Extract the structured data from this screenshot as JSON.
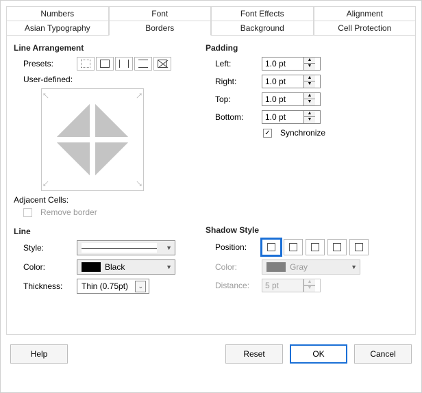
{
  "tabs": {
    "row1": [
      "Numbers",
      "Font",
      "Font Effects",
      "Alignment"
    ],
    "row2": [
      "Asian Typography",
      "Borders",
      "Background",
      "Cell Protection"
    ],
    "active": "Borders"
  },
  "arrangement": {
    "title": "Line Arrangement",
    "presets_label": "Presets:",
    "preset_names": [
      "no-borders",
      "box",
      "vertical-lines",
      "horizontal-lines",
      "diagonal-lines"
    ],
    "user_defined_label": "User-defined:",
    "adjacent_label": "Adjacent Cells:",
    "remove_border_label": "Remove border",
    "remove_border_checked": false,
    "remove_border_enabled": false
  },
  "padding": {
    "title": "Padding",
    "left_label": "Left:",
    "right_label": "Right:",
    "top_label": "Top:",
    "bottom_label": "Bottom:",
    "left": "1.0 pt",
    "right": "1.0 pt",
    "top": "1.0 pt",
    "bottom": "1.0 pt",
    "sync_label": "Synchronize",
    "sync_checked": true
  },
  "line": {
    "title": "Line",
    "style_label": "Style:",
    "color_label": "Color:",
    "thickness_label": "Thickness:",
    "color_name": "Black",
    "color_hex": "#000000",
    "thickness": "Thin (0.75pt)"
  },
  "shadow": {
    "title": "Shadow Style",
    "position_label": "Position:",
    "color_label": "Color:",
    "distance_label": "Distance:",
    "selected_index": 0,
    "option_names": [
      "no-shadow",
      "bottom-right",
      "top-right",
      "bottom-left",
      "top-left"
    ],
    "color_name": "Gray",
    "color_hex": "#808080",
    "distance": "5 pt",
    "enabled": false
  },
  "buttons": {
    "help": "Help",
    "reset": "Reset",
    "ok": "OK",
    "cancel": "Cancel"
  }
}
